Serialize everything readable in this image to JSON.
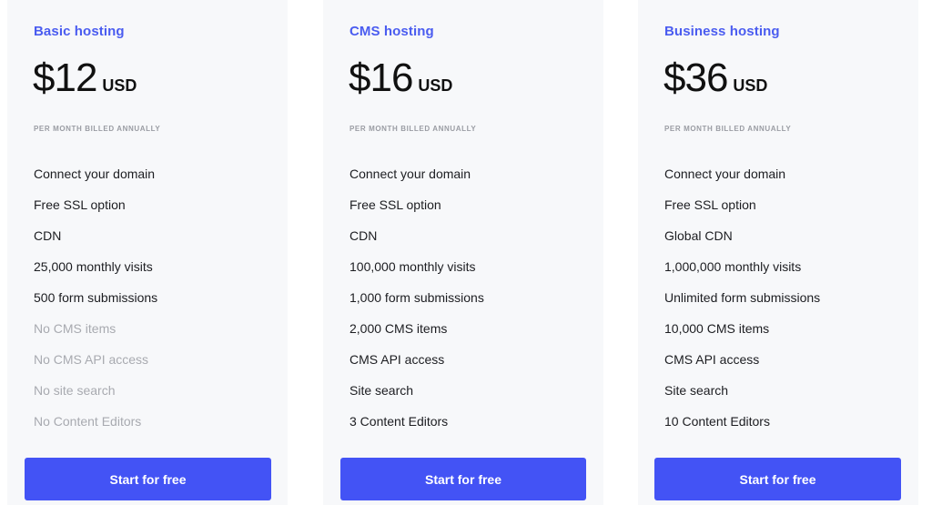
{
  "colors": {
    "accent": "#4a5cf0",
    "button": "#4353f5",
    "card_bg": "#f7f8fa",
    "muted_text": "#a8aab0"
  },
  "plans": [
    {
      "name": "Basic hosting",
      "price": "$12",
      "currency": "USD",
      "billing_note": "PER MONTH BILLED ANNUALLY",
      "features": [
        {
          "label": "Connect your domain",
          "included": true
        },
        {
          "label": "Free SSL option",
          "included": true
        },
        {
          "label": "CDN",
          "included": true
        },
        {
          "label": "25,000 monthly visits",
          "included": true
        },
        {
          "label": "500 form submissions",
          "included": true
        },
        {
          "label": "No CMS items",
          "included": false
        },
        {
          "label": "No CMS API access",
          "included": false
        },
        {
          "label": "No site search",
          "included": false
        },
        {
          "label": "No Content Editors",
          "included": false
        }
      ],
      "cta_label": "Start for free"
    },
    {
      "name": "CMS hosting",
      "price": "$16",
      "currency": "USD",
      "billing_note": "PER MONTH BILLED ANNUALLY",
      "features": [
        {
          "label": "Connect your domain",
          "included": true
        },
        {
          "label": "Free SSL option",
          "included": true
        },
        {
          "label": "CDN",
          "included": true
        },
        {
          "label": "100,000 monthly visits",
          "included": true
        },
        {
          "label": "1,000 form submissions",
          "included": true
        },
        {
          "label": "2,000 CMS items",
          "included": true
        },
        {
          "label": "CMS API access",
          "included": true
        },
        {
          "label": "Site search",
          "included": true
        },
        {
          "label": "3 Content Editors",
          "included": true
        }
      ],
      "cta_label": "Start for free"
    },
    {
      "name": "Business hosting",
      "price": "$36",
      "currency": "USD",
      "billing_note": "PER MONTH BILLED ANNUALLY",
      "features": [
        {
          "label": "Connect your domain",
          "included": true
        },
        {
          "label": "Free SSL option",
          "included": true
        },
        {
          "label": "Global CDN",
          "included": true
        },
        {
          "label": "1,000,000 monthly visits",
          "included": true
        },
        {
          "label": "Unlimited form submissions",
          "included": true
        },
        {
          "label": "10,000 CMS items",
          "included": true
        },
        {
          "label": "CMS API access",
          "included": true
        },
        {
          "label": "Site search",
          "included": true
        },
        {
          "label": "10 Content Editors",
          "included": true
        }
      ],
      "cta_label": "Start for free"
    }
  ]
}
